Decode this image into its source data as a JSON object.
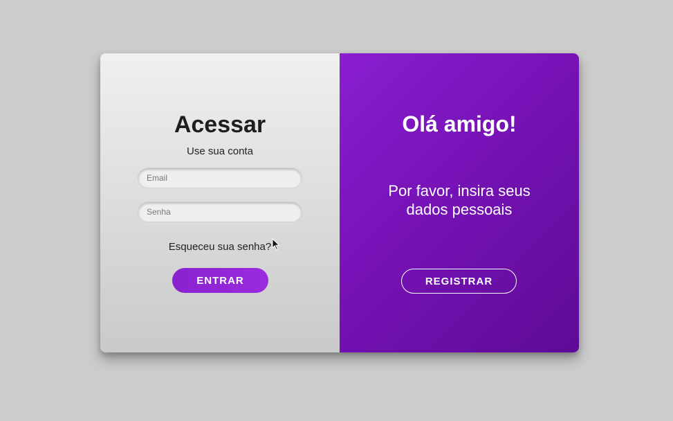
{
  "login": {
    "title": "Acessar",
    "subtitle": "Use sua conta",
    "email_placeholder": "Email",
    "password_placeholder": "Senha",
    "forgot_link": "Esqueceu sua senha?",
    "submit_label": "ENTRAR"
  },
  "welcome": {
    "title": "Olá amigo!",
    "message": "Por favor, insira seus dados pessoais",
    "register_label": "REGISTRAR"
  },
  "colors": {
    "page_background": "#cccccc",
    "accent_purple": "#8a22cf",
    "panel_purple_dark": "#5e0b96"
  },
  "icons": {
    "mouse_pointer": "arrow-cursor-icon"
  }
}
